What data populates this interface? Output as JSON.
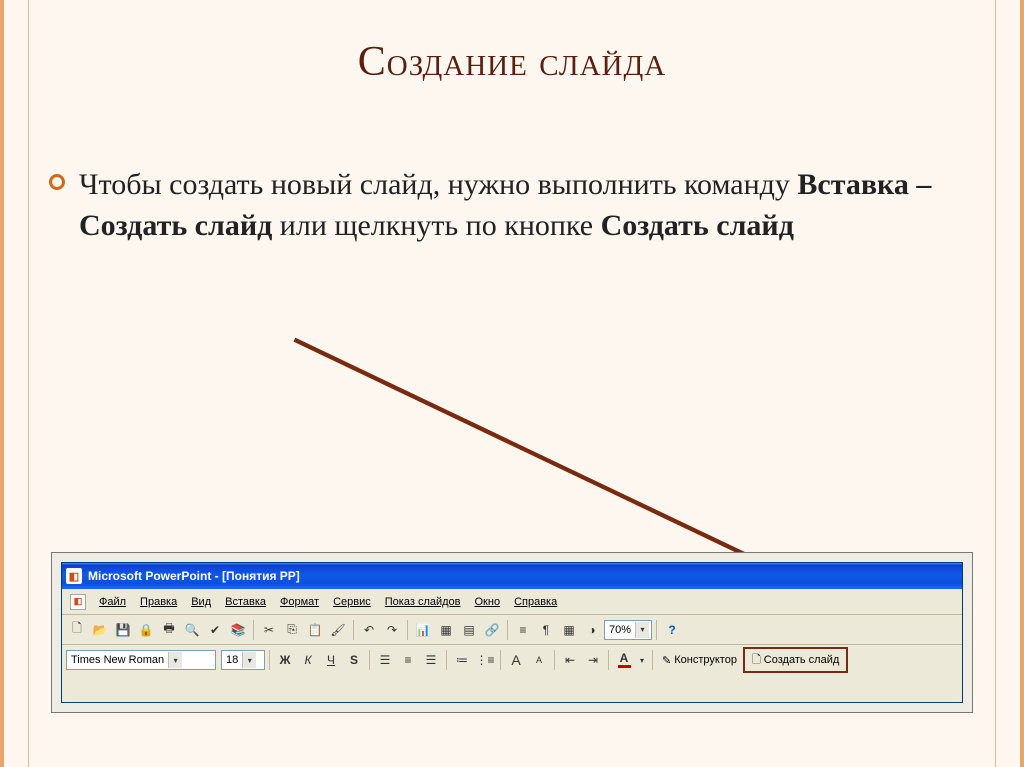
{
  "slide": {
    "title": "Создание слайда",
    "body_pre": "Чтобы создать новый слайд, нужно выполнить команду ",
    "body_bold1": "Вставка – Создать слайд",
    "body_mid": " или щелкнуть по кнопке ",
    "body_bold2": "Создать слайд"
  },
  "app": {
    "title": "Microsoft PowerPoint - [Понятия РР]",
    "menus": [
      "Файл",
      "Правка",
      "Вид",
      "Вставка",
      "Формат",
      "Сервис",
      "Показ слайдов",
      "Окно",
      "Справка"
    ],
    "zoom": "70%",
    "font_name": "Times New Roman",
    "font_size": "18",
    "format_buttons": {
      "bold": "Ж",
      "italic": "К",
      "underline": "Ч",
      "shadow": "S"
    },
    "increase_font": "A",
    "decrease_font": "A",
    "font_color_letter": "A",
    "constructor_label": "Конструктор",
    "new_slide_label": "Создать слайд"
  }
}
